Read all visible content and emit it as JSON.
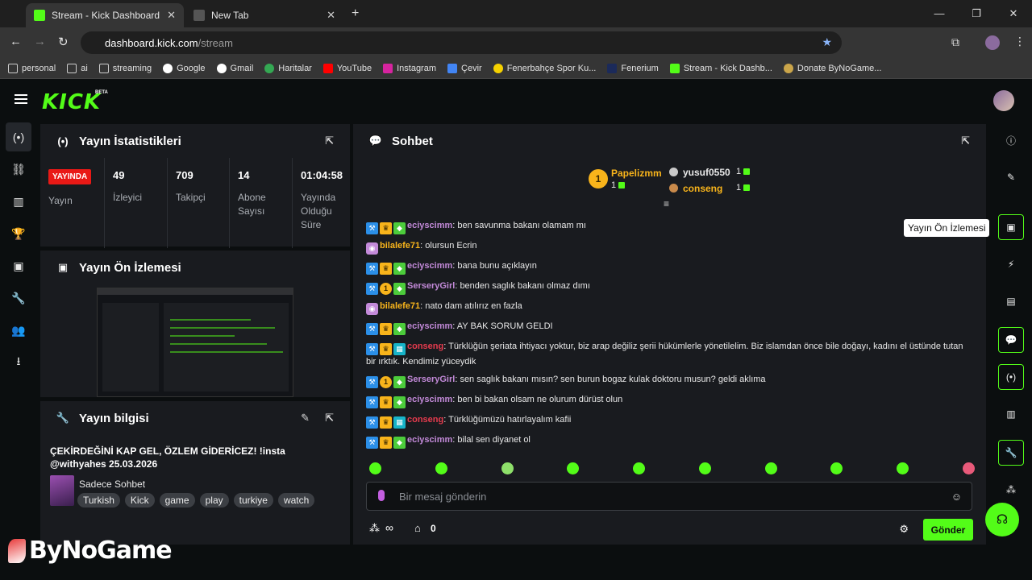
{
  "browser": {
    "tabs": [
      {
        "title": "Stream - Kick Dashboard",
        "active": true
      },
      {
        "title": "New Tab",
        "active": false
      }
    ],
    "url_host": "dashboard.kick.com",
    "url_path": "/stream",
    "bookmarks": [
      "personal",
      "ai",
      "streaming",
      "Google",
      "Gmail",
      "Haritalar",
      "YouTube",
      "Instagram",
      "Çevir",
      "Fenerbahçe Spor Ku...",
      "Fenerium",
      "Stream - Kick Dashb...",
      "Donate ByNoGame..."
    ]
  },
  "app": {
    "logo": "KICK",
    "beta": "BETA",
    "accent": "#53fc18"
  },
  "stats_panel": {
    "title": "Yayın İstatistikleri",
    "live_badge": "YAYINDA",
    "live_label": "Yayın",
    "items": [
      {
        "value": "49",
        "label": "İzleyici"
      },
      {
        "value": "709",
        "label": "Takipçi"
      },
      {
        "value": "14",
        "label": "Abone Sayısı"
      },
      {
        "value": "01:04:58",
        "label": "Yayında Olduğu Süre"
      }
    ]
  },
  "preview_panel": {
    "title": "Yayın Ön İzlemesi"
  },
  "info_panel": {
    "title": "Yayın bilgisi",
    "stream_title": "ÇEKİRDEĞİNİ KAP GEL, ÖZLEM GİDERİCEZ! !insta @withyahes 25.03.2026",
    "category": "Sadece Sohbet",
    "tags": [
      "Turkish",
      "Kick",
      "game",
      "play",
      "turkiye",
      "watch"
    ]
  },
  "chat": {
    "title": "Sohbet",
    "leaders": [
      {
        "rank": "1",
        "name": "Papelizmm",
        "count": "1"
      },
      {
        "name": "yusuf0550",
        "count": "1"
      },
      {
        "name": "conseng",
        "count": "1"
      }
    ],
    "messages": [
      {
        "user": "eciyscimm",
        "color": "#c38ad9",
        "text": ": ben savunma bakanı olamam mı"
      },
      {
        "user": "bilalefe71",
        "color": "#f8b41b",
        "text": ": olursun Ecrin"
      },
      {
        "user": "eciyscimm",
        "color": "#c38ad9",
        "text": ": bana bunu açıklayın"
      },
      {
        "user": "SerseryGirl",
        "color": "#c38ad9",
        "text": ": benden saglık bakanı olmaz dımı"
      },
      {
        "user": "bilalefe71",
        "color": "#f8b41b",
        "text": ": nato dam atılırız en fazla"
      },
      {
        "user": "eciyscimm",
        "color": "#c38ad9",
        "text": ": AY BAK SORUM GELDI"
      },
      {
        "user": "conseng",
        "color": "#e63b4e",
        "text": ": Türklüğün şeriata ihtiyacı yoktur, biz arap değiliz şerii hükümlerle yönetilelim. Biz islamdan önce bile doğayı, kadını el üstünde tutan bir ırktık. Kendimiz yüceydik"
      },
      {
        "user": "SerseryGirl",
        "color": "#c38ad9",
        "text": ": sen saglık bakanı mısın? sen burun bogaz kulak doktoru musun? geldi aklıma"
      },
      {
        "user": "eciyscimm",
        "color": "#c38ad9",
        "text": ": ben bi bakan olsam ne olurum dürüst olun"
      },
      {
        "user": "conseng",
        "color": "#e63b4e",
        "text": ": Türklüğümüzü hatırlayalım kafii"
      },
      {
        "user": "eciyscimm",
        "color": "#c38ad9",
        "text": ": bilal sen diyanet ol"
      }
    ],
    "input_placeholder": "Bir mesaj gönderin",
    "points": "∞",
    "store_count": "0",
    "send_label": "Gönder"
  },
  "tooltip": "Yayın Ön İzlemesi",
  "watermark": "ByNoGame"
}
